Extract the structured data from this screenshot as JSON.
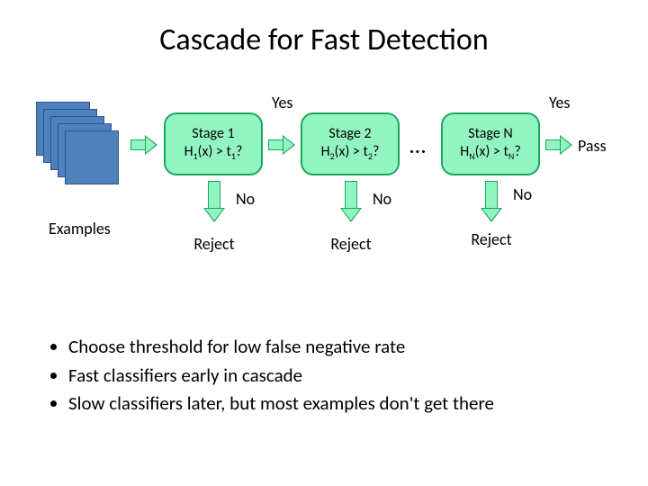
{
  "title": "Cascade for Fast Detection",
  "diagram": {
    "examples_label": "Examples",
    "stages": [
      {
        "name": "Stage 1",
        "condition_prefix": "H",
        "sub": "1",
        "condition_suffix": "(x) > t",
        "sub2": "1",
        "q": "?"
      },
      {
        "name": "Stage 2",
        "condition_prefix": "H",
        "sub": "2",
        "condition_suffix": "(x) > t",
        "sub2": "2",
        "q": "?"
      },
      {
        "name": "Stage N",
        "condition_prefix": "H",
        "sub": "N",
        "condition_suffix": "(x) > t",
        "sub2": "N",
        "q": "?"
      }
    ],
    "labels": {
      "yes": "Yes",
      "no": "No",
      "reject": "Reject",
      "pass": "Pass",
      "ellipsis": "…"
    }
  },
  "bullets": [
    "Choose threshold for low false negative rate",
    "Fast classifiers early in cascade",
    "Slow classifiers later, but most examples don't get there"
  ]
}
